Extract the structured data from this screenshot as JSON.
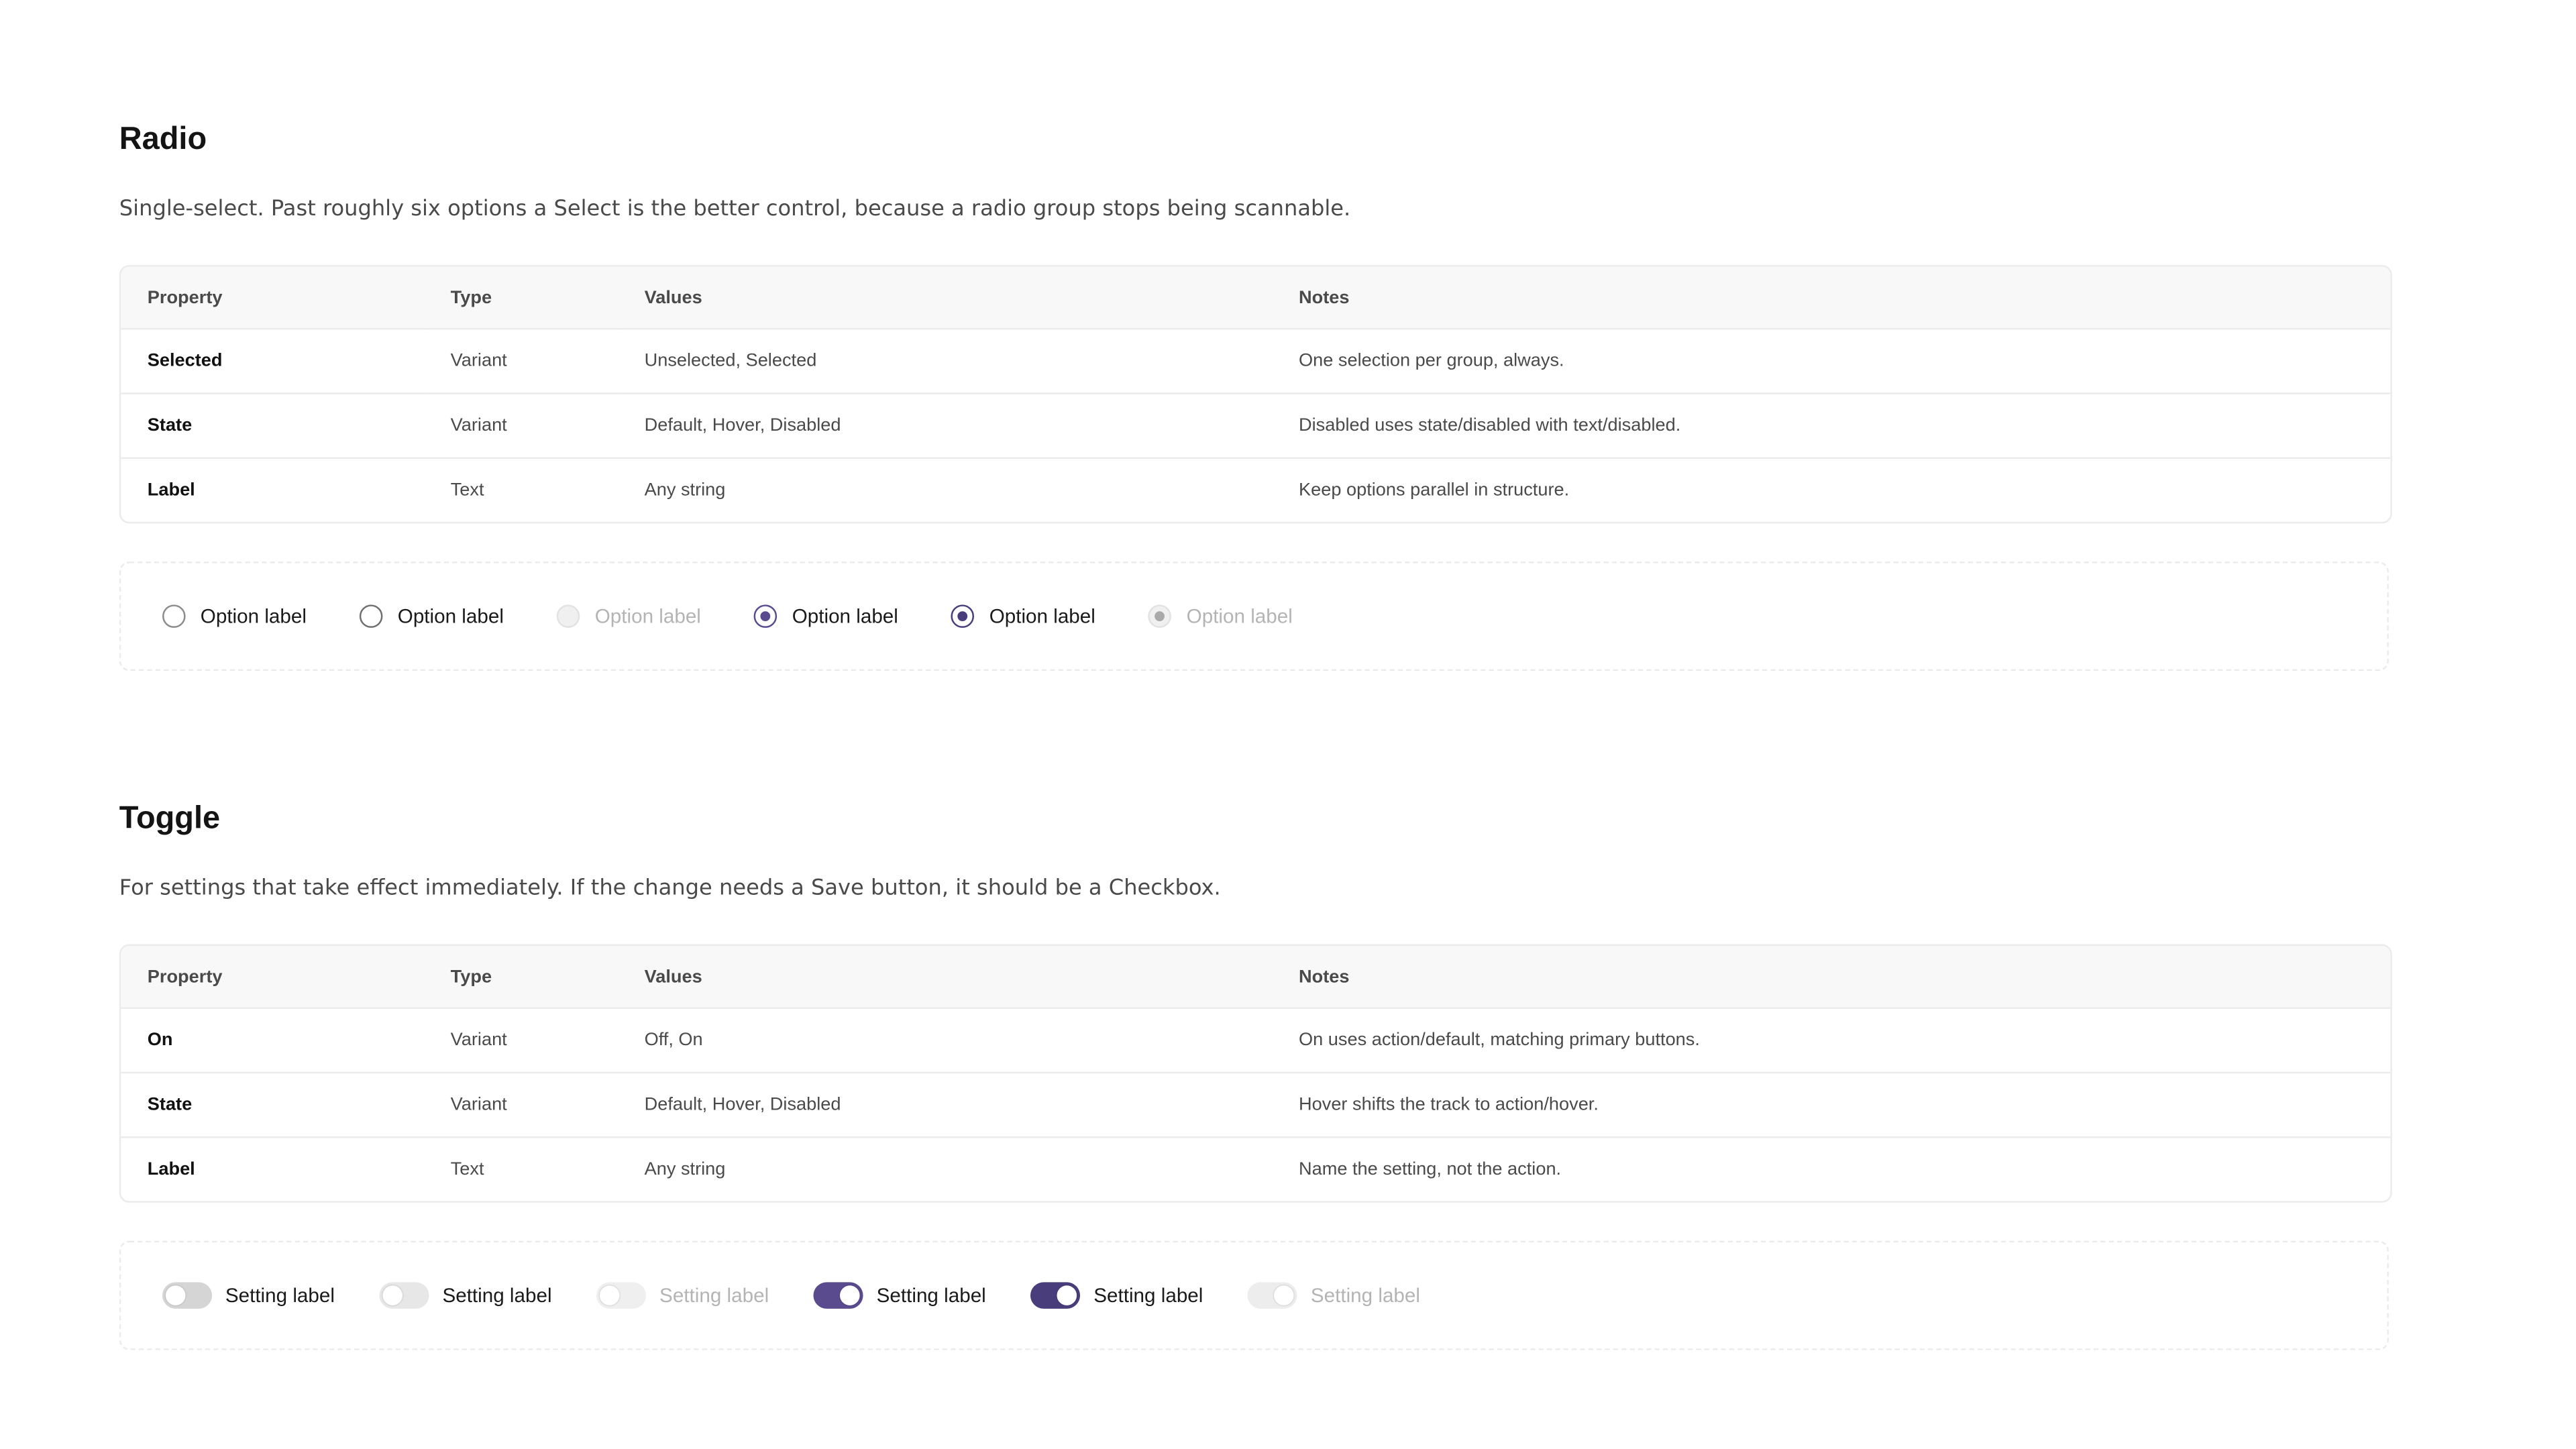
{
  "sections": {
    "radio": {
      "title": "Radio",
      "description": "Single-select. Past roughly six options a Select is the better control, because a radio group stops being scannable.",
      "headers": {
        "property": "Property",
        "type": "Type",
        "values": "Values",
        "notes": "Notes"
      },
      "rows": [
        {
          "property": "Selected",
          "type": "Variant",
          "values": "Unselected, Selected",
          "notes": "One selection per group, always."
        },
        {
          "property": "State",
          "type": "Variant",
          "values": "Default, Hover, Disabled",
          "notes": "Disabled uses state/disabled with text/disabled."
        },
        {
          "property": "Label",
          "type": "Text",
          "values": "Any string",
          "notes": "Keep options parallel in structure."
        }
      ],
      "examples": [
        {
          "label": "Option label",
          "selected": false,
          "state": "default"
        },
        {
          "label": "Option label",
          "selected": false,
          "state": "hover"
        },
        {
          "label": "Option label",
          "selected": false,
          "state": "disabled"
        },
        {
          "label": "Option label",
          "selected": true,
          "state": "default"
        },
        {
          "label": "Option label",
          "selected": true,
          "state": "hover"
        },
        {
          "label": "Option label",
          "selected": true,
          "state": "disabled"
        }
      ]
    },
    "toggle": {
      "title": "Toggle",
      "description": "For settings that take effect immediately. If the change needs a Save button, it should be a Checkbox.",
      "headers": {
        "property": "Property",
        "type": "Type",
        "values": "Values",
        "notes": "Notes"
      },
      "rows": [
        {
          "property": "On",
          "type": "Variant",
          "values": "Off, On",
          "notes": "On uses action/default, matching primary buttons."
        },
        {
          "property": "State",
          "type": "Variant",
          "values": "Default, Hover, Disabled",
          "notes": "Hover shifts the track to action/hover."
        },
        {
          "property": "Label",
          "type": "Text",
          "values": "Any string",
          "notes": "Name the setting, not the action."
        }
      ],
      "examples": [
        {
          "label": "Setting label",
          "on": false,
          "state": "default"
        },
        {
          "label": "Setting label",
          "on": false,
          "state": "hover"
        },
        {
          "label": "Setting label",
          "on": false,
          "state": "disabled"
        },
        {
          "label": "Setting label",
          "on": true,
          "state": "default"
        },
        {
          "label": "Setting label",
          "on": true,
          "state": "hover"
        },
        {
          "label": "Setting label",
          "on": true,
          "state": "disabled"
        }
      ]
    }
  },
  "colors": {
    "action_default": "#5a4b8f",
    "action_hover": "#4a3d7c",
    "text_disabled": "#b4b4b4",
    "border": "#ebebeb"
  }
}
